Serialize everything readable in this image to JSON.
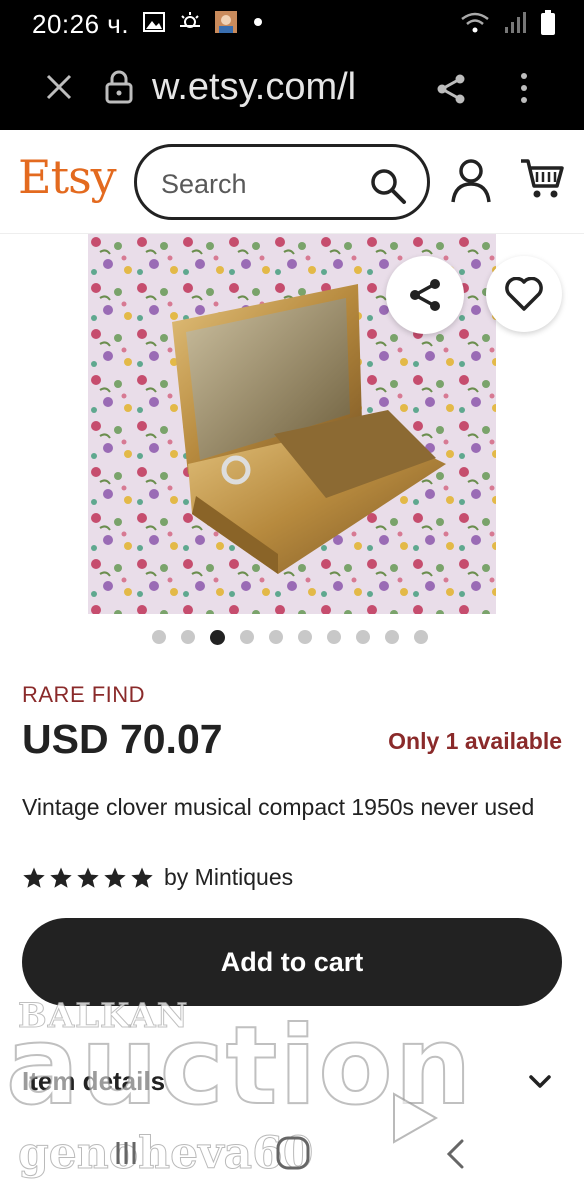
{
  "status_bar": {
    "time": "20:26 ч."
  },
  "browser": {
    "url": "w.etsy.com/l"
  },
  "header": {
    "logo": "Etsy",
    "search_placeholder": "Search"
  },
  "carousel": {
    "total": 10,
    "active_index": 2
  },
  "product": {
    "badge": "RARE FIND",
    "price": "USD 70.07",
    "availability": "Only 1 available",
    "title": "Vintage clover musical compact 1950s never used",
    "rating_stars": 5,
    "shop": "by Mintiques",
    "add_to_cart_label": "Add to cart",
    "item_details_label": "Item details"
  },
  "watermark": {
    "brand_top": "BALKAN",
    "brand_main": "auction",
    "seller": "genoheva60"
  },
  "colors": {
    "brand_orange": "#e36a1f",
    "accent_red": "#8a2a2a",
    "button_dark": "#222222"
  }
}
